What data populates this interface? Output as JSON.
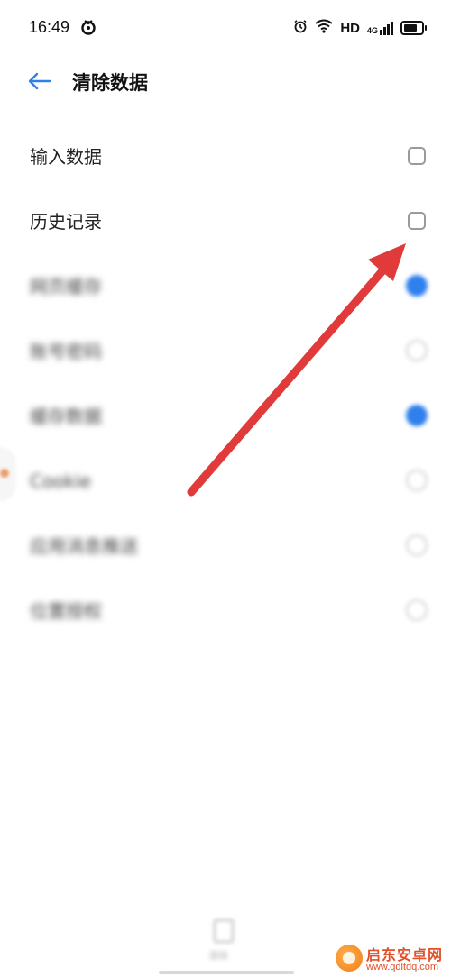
{
  "status_bar": {
    "time": "16:49",
    "hd": "HD",
    "network": "4G",
    "icons": [
      "app-notification-icon",
      "alarm-icon",
      "wifi-icon",
      "signal-icon",
      "battery-icon"
    ]
  },
  "header": {
    "title": "清除数据",
    "back_icon": "arrow-left-icon"
  },
  "list": {
    "items": [
      {
        "label": "输入数据",
        "checked": false
      },
      {
        "label": "历史记录",
        "checked": false
      },
      {
        "label": "网页缓存",
        "checked": true
      },
      {
        "label": "账号密码",
        "checked": false
      },
      {
        "label": "缓存数据",
        "checked": true
      },
      {
        "label": "Cookie",
        "checked": false
      },
      {
        "label": "应用消息推送",
        "checked": false
      },
      {
        "label": "位置授权",
        "checked": false
      }
    ]
  },
  "bottom_nav": {
    "label": "清除"
  },
  "watermark": {
    "title": "启东安卓网",
    "url": "www.qdltdq.com"
  },
  "colors": {
    "accent": "#2f80ed",
    "back_icon": "#2f80ed",
    "annotation_arrow": "#e03a3a",
    "watermark": "#e2502a"
  }
}
